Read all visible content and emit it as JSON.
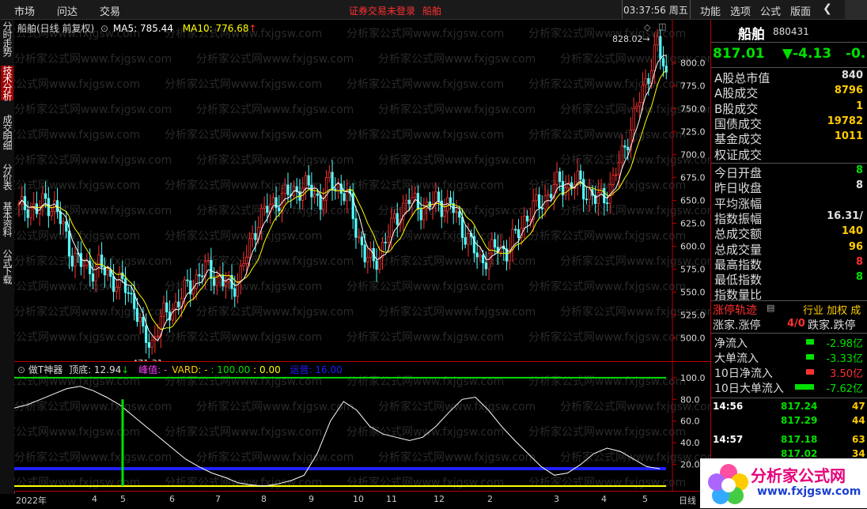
{
  "topbar": {
    "menu": [
      "市场",
      "问达",
      "交易"
    ],
    "login_warning": "证券交易未登录",
    "stock_name": "船舶",
    "clock": "03:37:56 周五",
    "right_menu": [
      "功能",
      "选项",
      "公式",
      "版面"
    ],
    "nav_back_icon": "chevron-left-icon"
  },
  "left_tabs": [
    {
      "label": "分时走势",
      "active": false
    },
    {
      "label": "技术分析",
      "active": true
    },
    {
      "label": "成交明细",
      "active": false
    },
    {
      "label": "分价表",
      "active": false
    },
    {
      "label": "基本资料",
      "active": false
    },
    {
      "label": "公式下载",
      "active": false
    }
  ],
  "main_legend": {
    "title": "船舶(日线 前复权)",
    "ma5_label": "MA5: 785.44",
    "ma10_label": "MA10: 776.68",
    "up_arrow": "↑"
  },
  "price_annotations": {
    "high": "828.02",
    "low": "471.31"
  },
  "watermark": "分析家公式网www.fxjgsw.com",
  "sub_legend": {
    "name": "做T神器",
    "top_bottom": "顶底: 12.94",
    "peak": "峰值: -",
    "vard": "VARD: -",
    "v100": ": 100.00",
    "v0": ": 0.00",
    "extra": "运营: 16.00"
  },
  "x_axis": [
    "2022年",
    "4",
    "5",
    "6",
    "7",
    "8",
    "9",
    "10",
    "11",
    "12",
    "2",
    "3",
    "4",
    "5",
    "日线"
  ],
  "colors": {
    "up": "#ff3232",
    "down": "#54ffff",
    "ma5": "#ffffff",
    "ma10": "#ffff00",
    "accent_red": "#ff3030",
    "green": "#00e000"
  },
  "chart_data": [
    {
      "type": "candlestick",
      "title": "船舶(日线 前复权)",
      "y_ticks": [
        500.0,
        525.0,
        550.0,
        575.0,
        600.0,
        625.0,
        650.0,
        675.0,
        700.0,
        725.0,
        750.0,
        775.0,
        800.0
      ],
      "ylim": [
        478,
        835
      ],
      "y_tick_labels": [
        "500.0",
        "525.0",
        "550.0",
        "575.0",
        "600.0",
        "625.0",
        "650.0",
        "675.0",
        "700.0",
        "725.0",
        "750.0",
        "775.0",
        "800.0"
      ],
      "close_profile": [
        640,
        645,
        638,
        650,
        642,
        620,
        590,
        580,
        575,
        578,
        570,
        560,
        555,
        540,
        500,
        495,
        520,
        530,
        540,
        555,
        565,
        575,
        570,
        560,
        555,
        570,
        600,
        630,
        640,
        650,
        655,
        660,
        665,
        660,
        650,
        670,
        665,
        655,
        620,
        590,
        580,
        600,
        620,
        640,
        650,
        645,
        640,
        650,
        645,
        640,
        620,
        600,
        585,
        590,
        600,
        595,
        610,
        630,
        640,
        650,
        660,
        670,
        665,
        670,
        660,
        650,
        655,
        670,
        700,
        730,
        760,
        790,
        820,
        785
      ],
      "ma5_last": 785.44,
      "ma10_last": 776.68,
      "high_mark": 828.02,
      "low_mark": 471.31
    },
    {
      "type": "line",
      "title": "做T神器",
      "y_ticks": [
        20.0,
        40.0,
        60.0,
        80.0,
        100.0
      ],
      "y_tick_labels": [
        "20.0",
        "40.0",
        "60.0",
        "80.0",
        "100.0"
      ],
      "ylim": [
        0,
        105
      ],
      "reference_lines": [
        {
          "value": 100.0,
          "color": "#00e000"
        },
        {
          "value": 0.0,
          "color": "#ffff00"
        },
        {
          "value": 16.0,
          "color": "#2020ff"
        }
      ],
      "oscillator": [
        72,
        75,
        80,
        85,
        90,
        92,
        88,
        82,
        75,
        65,
        55,
        45,
        35,
        25,
        18,
        12,
        8,
        3,
        1,
        0,
        2,
        5,
        10,
        30,
        60,
        78,
        70,
        55,
        48,
        45,
        42,
        45,
        55,
        68,
        80,
        82,
        70,
        55,
        42,
        30,
        18,
        10,
        12,
        20,
        30,
        35,
        32,
        25,
        18,
        16
      ],
      "signal_bar": {
        "x_index": 9,
        "value": 80
      }
    }
  ],
  "right_panel": {
    "name": "船舶",
    "code": "880431",
    "price": "817.01",
    "change": "▼-4.13",
    "change_pct": "-0.",
    "rows1": [
      {
        "label": "A股总市值",
        "value": "840",
        "color": "#e0e0e0"
      },
      {
        "label": "A股成交",
        "value": "8796",
        "color": "#ffcc00"
      },
      {
        "label": "B股成交",
        "value": "1",
        "color": "#ffcc00"
      },
      {
        "label": "国债成交",
        "value": "19782",
        "color": "#ffcc00"
      },
      {
        "label": "基金成交",
        "value": "1011",
        "color": "#ffcc00"
      },
      {
        "label": "权证成交",
        "value": "",
        "color": "#ffcc00"
      }
    ],
    "rows2": [
      {
        "label": "今日开盘",
        "value": "8",
        "color": "#00e000"
      },
      {
        "label": "昨日收盘",
        "value": "8",
        "color": "#e0e0e0"
      },
      {
        "label": "平均涨幅",
        "value": "",
        "color": "#e0e0e0"
      },
      {
        "label": "指数振幅",
        "value": "16.31/",
        "color": "#e0e0e0"
      },
      {
        "label": "总成交额",
        "value": "140",
        "color": "#ffcc00"
      },
      {
        "label": "总成交量",
        "value": "96",
        "color": "#ffcc00"
      },
      {
        "label": "最高指数",
        "value": "8",
        "color": "#ff3030"
      },
      {
        "label": "最低指数",
        "value": "8",
        "color": "#00e000"
      },
      {
        "label": "指数量比",
        "value": "",
        "color": "#e0e0e0"
      }
    ],
    "zt_title": "涨停轨迹",
    "zt_tabs": "行业 加权 成",
    "zt_row": {
      "left": "涨家.涨停",
      "mid": "4/0",
      "right": "跌家.跌停"
    },
    "flows": [
      {
        "label": "净流入",
        "value": "-2.98亿",
        "color": "#00e000",
        "bar": 10
      },
      {
        "label": "大单流入",
        "value": "-3.33亿",
        "color": "#00e000",
        "bar": 10
      },
      {
        "label": "10日净流入",
        "value": "3.50亿",
        "color": "#ff3030",
        "bar": 10
      },
      {
        "label": "10日大单流入",
        "value": "-7.62亿",
        "color": "#00e000",
        "bar": 24
      }
    ],
    "ticks": [
      {
        "time": "14:56",
        "price": "817.24",
        "vol": "47"
      },
      {
        "time": "",
        "price": "817.29",
        "vol": "44"
      },
      {
        "time": "14:57",
        "price": "817.18",
        "vol": "63"
      },
      {
        "time": "",
        "price": "817.02",
        "vol": "34"
      },
      {
        "time": "",
        "price": "816.74",
        "vol": "15"
      }
    ]
  },
  "logo": {
    "name": "分析家公式网",
    "url": "www.fxjgsw.com"
  }
}
